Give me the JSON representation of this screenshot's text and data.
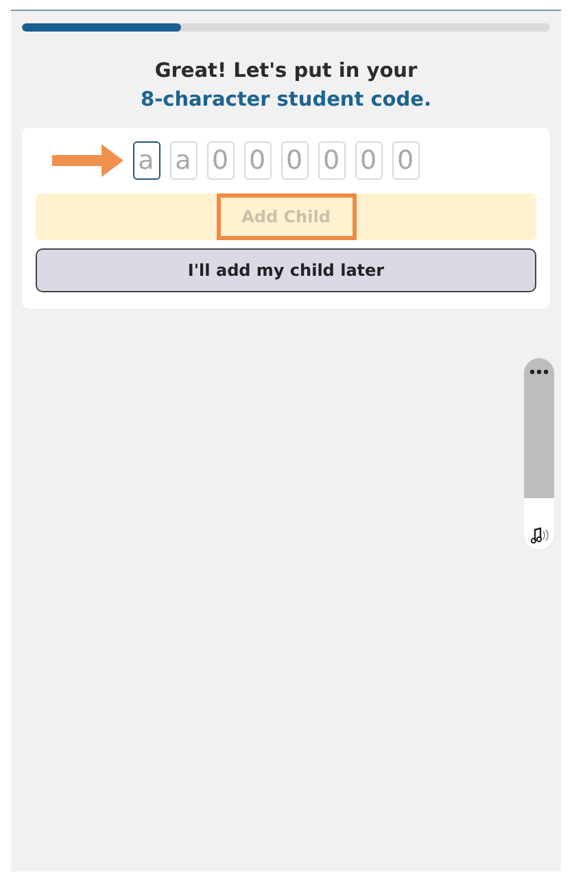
{
  "progress": {
    "level": 0.3
  },
  "heading": {
    "line_1": "Great! Let's put in your",
    "line_2": "8-character student code."
  },
  "code_fields": [
    {
      "placeholder": "a",
      "selected": true
    },
    {
      "placeholder": "a",
      "selected": false
    },
    {
      "placeholder": "0",
      "selected": false
    },
    {
      "placeholder": "0",
      "selected": false
    },
    {
      "placeholder": "0",
      "selected": false
    },
    {
      "placeholder": "0",
      "selected": false
    },
    {
      "placeholder": "0",
      "selected": false
    },
    {
      "placeholder": "0",
      "selected": false
    }
  ],
  "add_child_button": {
    "label": "Add Child",
    "disabled": true
  },
  "later_button": {
    "label": "I'll add my child later"
  },
  "volume_slider": {
    "level": 0.27
  }
}
